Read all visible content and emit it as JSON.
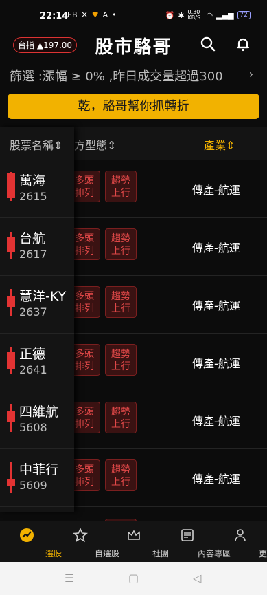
{
  "status": {
    "time": "22:14",
    "left_icons": [
      "EB",
      "✕",
      "♥",
      "A",
      "•"
    ],
    "battery": "72",
    "network": "0.30 KB/S"
  },
  "app": {
    "index_label": "台指",
    "index_change": "▲197.00",
    "title": "股市駱哥"
  },
  "filter": {
    "text": "篩選 :漲幅 ≥ 0% ,昨日成交量超過300"
  },
  "cta": {
    "label": "乾，駱哥幫你抓轉折"
  },
  "columns": {
    "name": "股票名稱",
    "pattern": "方型態",
    "industry": "產業"
  },
  "stocks": [
    {
      "name": "萬海",
      "code": "2615",
      "tag1": [
        "多頭",
        "排列"
      ],
      "tag2": [
        "趨勢",
        "上行"
      ],
      "industry": "傳產-航運"
    },
    {
      "name": "台航",
      "code": "2617",
      "tag1": [
        "多頭",
        "排列"
      ],
      "tag2": [
        "趨勢",
        "上行"
      ],
      "industry": "傳產-航運"
    },
    {
      "name": "慧洋-KY",
      "code": "2637",
      "tag1": [
        "多頭",
        "排列"
      ],
      "tag2": [
        "趨勢",
        "上行"
      ],
      "industry": "傳產-航運"
    },
    {
      "name": "正德",
      "code": "2641",
      "tag1": [
        "多頭",
        "排列"
      ],
      "tag2": [
        "趨勢",
        "上行"
      ],
      "industry": "傳產-航運"
    },
    {
      "name": "四維航",
      "code": "5608",
      "tag1": [
        "多頭",
        "排列"
      ],
      "tag2": [
        "趨勢",
        "上行"
      ],
      "industry": "傳產-航運"
    },
    {
      "name": "中菲行",
      "code": "5609",
      "tag1": [
        "多頭",
        "排列"
      ],
      "tag2": [
        "趨勢",
        "上行"
      ],
      "industry": "傳產-航運"
    }
  ],
  "nav": {
    "items": [
      {
        "label": "選股",
        "icon": "stock-pick-icon"
      },
      {
        "label": "自選股",
        "icon": "star-icon"
      },
      {
        "label": "社團",
        "icon": "crown-icon"
      },
      {
        "label": "內容專區",
        "icon": "news-icon"
      },
      {
        "label": "更多",
        "icon": "person-icon"
      }
    ]
  },
  "colors": {
    "accent": "#f2b200",
    "up": "#e23333",
    "bg": "#0c0c0c"
  }
}
